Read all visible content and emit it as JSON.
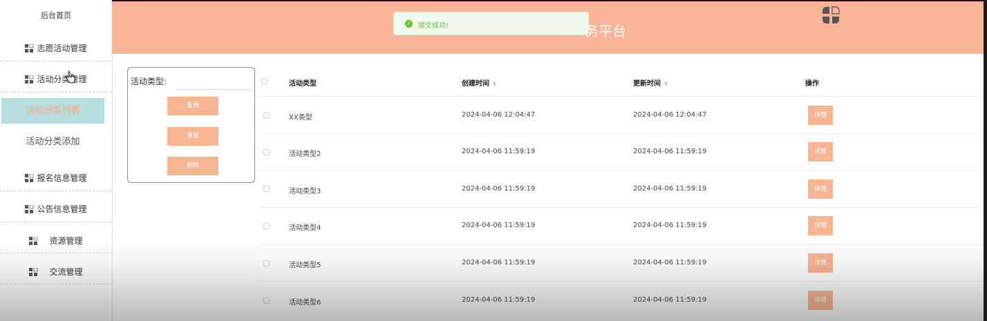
{
  "sidebar": {
    "home": "后台首页",
    "items": [
      {
        "label": "志愿活动管理"
      },
      {
        "label": "活动分类管理"
      },
      {
        "label": "报名信息管理"
      },
      {
        "label": "公告信息管理"
      },
      {
        "label": "资源管理"
      },
      {
        "label": "交流管理"
      }
    ],
    "sub_items": [
      {
        "label": "活动分类列表",
        "active": true
      },
      {
        "label": "活动分类添加",
        "active": false
      }
    ]
  },
  "header": {
    "title_visible": "务平台",
    "bg_color": "#fab598"
  },
  "toast": {
    "icon": "success-check-icon",
    "text": "提交成功!"
  },
  "search": {
    "label": "活动类型:",
    "value": "",
    "buttons": {
      "query": "查询",
      "reset": "重置",
      "delete": "删除"
    }
  },
  "table": {
    "headers": {
      "type": "活动类型",
      "created": "创建时间",
      "updated": "更新时间",
      "action": "操作"
    },
    "rows": [
      {
        "type": "XX类型",
        "created": "2024-04-06 12:04:47",
        "updated": "2024-04-06 12:04:47",
        "action": "详情"
      },
      {
        "type": "活动类型2",
        "created": "2024-04-06 11:59:19",
        "updated": "2024-04-06 11:59:19",
        "action": "详情"
      },
      {
        "type": "活动类型3",
        "created": "2024-04-06 11:59:19",
        "updated": "2024-04-06 11:59:19",
        "action": "详情"
      },
      {
        "type": "活动类型4",
        "created": "2024-04-06 11:59:19",
        "updated": "2024-04-06 11:59:19",
        "action": "详情"
      },
      {
        "type": "活动类型5",
        "created": "2024-04-06 11:59:19",
        "updated": "2024-04-06 11:59:19",
        "action": "详情"
      },
      {
        "type": "活动类型6",
        "created": "2024-04-06 11:59:19",
        "updated": "2024-04-06 11:59:19",
        "action": "详情"
      }
    ]
  },
  "colors": {
    "accent": "#f8b594",
    "active_menu_bg": "#b7dede",
    "toast_text": "#67c23a"
  }
}
